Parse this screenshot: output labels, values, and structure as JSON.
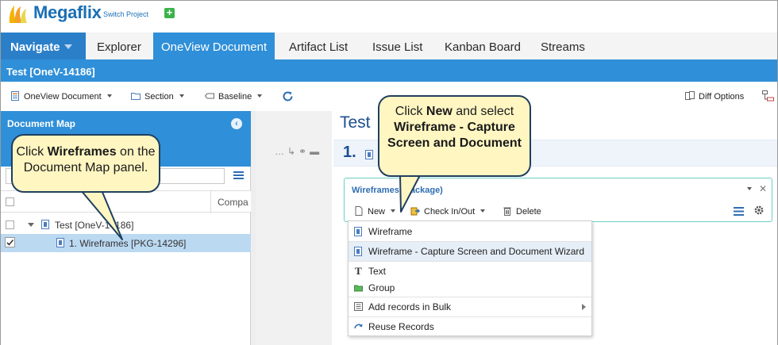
{
  "app": {
    "name": "Megaflix",
    "switch_project": "Switch Project"
  },
  "nav": {
    "navigate": "Navigate",
    "items": [
      "Explorer",
      "OneView Document",
      "Artifact List",
      "Issue List",
      "Kanban Board",
      "Streams"
    ],
    "active": "OneView Document"
  },
  "title": "Test [OneV-14186]",
  "toolbar": {
    "oneview_document": "OneView Document",
    "section": "Section",
    "baseline": "Baseline",
    "diff_options": "Diff Options"
  },
  "document_map": {
    "header": "Document Map",
    "column_label": "Compa",
    "tree": [
      {
        "label": "Test [OneV-14186]",
        "checked": false,
        "selected": false
      },
      {
        "label": "1. Wireframes [PKG-14296]",
        "checked": true,
        "selected": true
      }
    ]
  },
  "main": {
    "heading": "Test",
    "section_number": "1."
  },
  "panel": {
    "title": "Wireframes (Package)",
    "new": "New",
    "check_in_out": "Check In/Out",
    "delete": "Delete"
  },
  "new_menu": {
    "items": [
      {
        "label": "Wireframe",
        "icon": "wireframe-icon"
      },
      {
        "label": "Wireframe - Capture Screen and Document Wizard",
        "icon": "wireframe-icon",
        "highlighted": true
      },
      {
        "label": "Text",
        "icon": "text-icon"
      },
      {
        "label": "Group",
        "icon": "group-icon"
      },
      {
        "label": "Add records in Bulk",
        "icon": "bulk-add-icon",
        "submenu": true
      },
      {
        "label": "Reuse Records",
        "icon": "reuse-icon"
      }
    ]
  },
  "callouts": {
    "left": {
      "pre": "Click ",
      "bold": "Wireframes",
      "post": " on the Document Map panel."
    },
    "right": {
      "pre": "Click ",
      "bold1": "New",
      "mid": " and select ",
      "bold2": "Wireframe - Capture Screen and Document"
    }
  },
  "colors": {
    "accent": "#2f8fd8",
    "brand": "#1a6fb5",
    "callout_fill": "#fff6c2",
    "panel_border": "#6ccfc3"
  }
}
